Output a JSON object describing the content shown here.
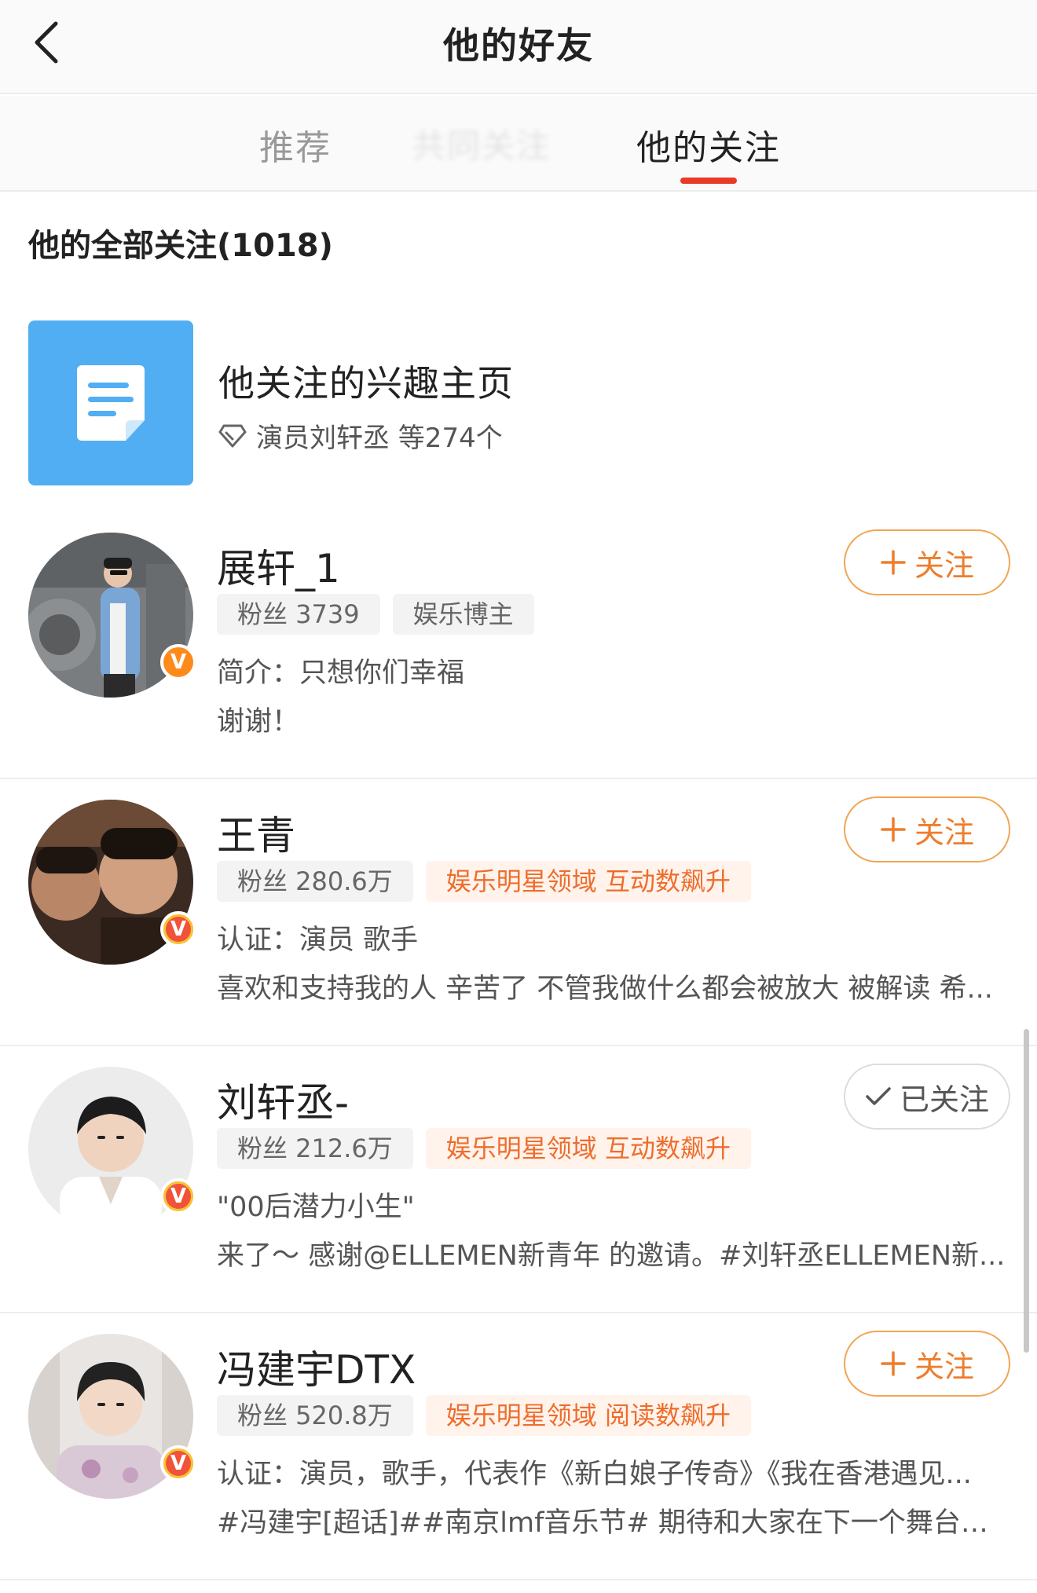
{
  "header": {
    "title": "他的好友",
    "back_icon": "chevron-left-icon"
  },
  "tabs": [
    {
      "label": "推荐"
    },
    {
      "label": "共同关注"
    },
    {
      "label": "他的关注",
      "active": true
    }
  ],
  "section_title": "他的全部关注(1018)",
  "interest_page": {
    "title": "他关注的兴趣主页",
    "subtitle": "演员刘轩丞 等274个",
    "icon": "document-icon",
    "tile_color": "#52aef2"
  },
  "users": [
    {
      "name": "展轩_1",
      "tags": [
        {
          "text": "粉丝 3739",
          "hot": false
        },
        {
          "text": "娱乐博主",
          "hot": false
        }
      ],
      "line1": "简介：只想你们幸福",
      "line2": "谢谢！",
      "button": "关注",
      "followed": false,
      "badge": "V"
    },
    {
      "name": "王青",
      "tags": [
        {
          "text": "粉丝 280.6万",
          "hot": false
        },
        {
          "text": "娱乐明星领域 互动数飙升",
          "hot": true
        }
      ],
      "line1": "认证：演员 歌手",
      "line2": "喜欢和支持我的人 辛苦了 不管我做什么都会被放大 被解读 希...",
      "button": "关注",
      "followed": false,
      "badge": "V"
    },
    {
      "name": "刘轩丞-",
      "tags": [
        {
          "text": "粉丝 212.6万",
          "hot": false
        },
        {
          "text": "娱乐明星领域 互动数飙升",
          "hot": true
        }
      ],
      "line1": "\"00后潜力小生\"",
      "line2": "来了～ 感谢@ELLEMEN新青年 的邀请。#刘轩丞ELLEMEN新...",
      "button": "已关注",
      "followed": true,
      "badge": "V"
    },
    {
      "name": "冯建宇DTX",
      "tags": [
        {
          "text": "粉丝 520.8万",
          "hot": false
        },
        {
          "text": "娱乐明星领域 阅读数飙升",
          "hot": true
        }
      ],
      "line1": "认证：演员，歌手，代表作《新白娘子传奇》《我在香港遇见...",
      "line2": "#冯建宇[超话]##南京lmf音乐节# 期待和大家在下一个舞台相...",
      "button": "关注",
      "followed": false,
      "badge": "V"
    }
  ],
  "colors": {
    "accent": "#ee7d2c",
    "tab_indicator": "#ea3b2a",
    "verified_orange": "#ff8a1c",
    "verified_red": "#f0533a"
  }
}
